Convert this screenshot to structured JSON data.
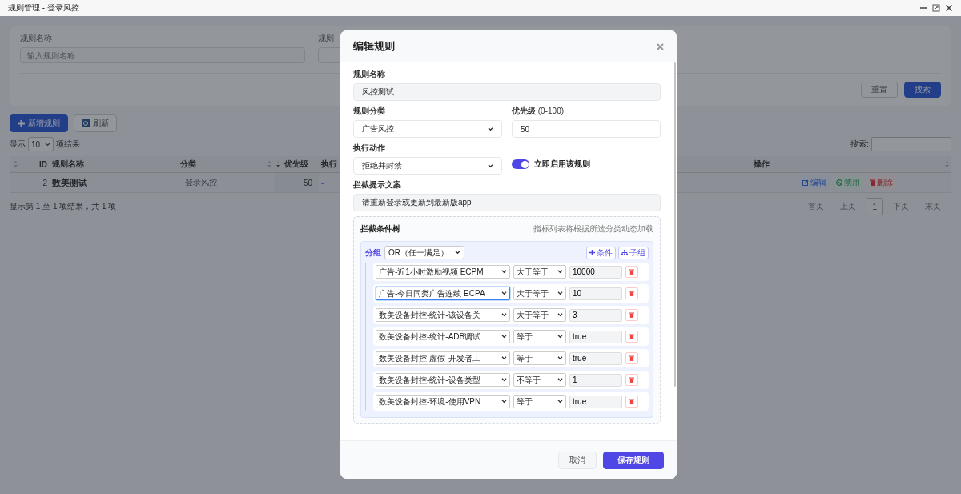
{
  "window": {
    "title": "规则管理 - 登录风控"
  },
  "filters": [
    {
      "label": "规则名称",
      "placeholder": "输入规则名称"
    },
    {
      "label": "规则"
    }
  ],
  "filter_buttons": [
    {
      "label": "重置",
      "kind": "secondary"
    },
    {
      "label": "搜索",
      "kind": "primary"
    }
  ],
  "toolbar": [
    {
      "label": "新增规则",
      "kind": "add"
    },
    {
      "label": "刷新",
      "kind": "refresh"
    }
  ],
  "page_length": {
    "prefix": "显示",
    "value": "10",
    "suffix": "项结果"
  },
  "search": {
    "label": "搜索:"
  },
  "table": {
    "columns": [
      {
        "kind": "check"
      },
      {
        "label": "ID"
      },
      {
        "label": "规则名称"
      },
      {
        "label": "分类"
      },
      {
        "label": "优先级"
      },
      {
        "label": "执行"
      },
      {
        "label": "操作"
      }
    ],
    "rows": [
      {
        "id": "2",
        "name": "数美测试",
        "category": "登录风控",
        "priority": "50",
        "action": "-",
        "actions": [
          {
            "label": "编辑",
            "kind": "edit"
          },
          {
            "label": "禁用",
            "kind": "disable"
          },
          {
            "label": "删除",
            "kind": "delete"
          }
        ]
      }
    ]
  },
  "info": "显示第 1 至 1 项结果，共 1 项",
  "pagination": [
    {
      "label": "首页",
      "selected": false
    },
    {
      "label": "上页",
      "selected": false
    },
    {
      "label": "1",
      "selected": true
    },
    {
      "label": "下页",
      "selected": false
    },
    {
      "label": "末页",
      "selected": false
    }
  ],
  "modal": {
    "title": "编辑规则",
    "name": {
      "label": "规则名称",
      "value": "风控测试"
    },
    "category": {
      "label": "规则分类",
      "value": "广告风控"
    },
    "priority": {
      "label": "优先级",
      "hint": "(0-100)",
      "value": "50"
    },
    "action": {
      "label": "执行动作",
      "value": "拒绝并封禁"
    },
    "enable": {
      "label": "立即启用该规则",
      "on": true
    },
    "message": {
      "label": "拦截提示文案",
      "value": "请重新登录或更新到最新版app"
    },
    "tree": {
      "title": "拦截条件树",
      "hint": "指标列表将根据所选分类动态加载",
      "group": {
        "label": "分组",
        "logic": "OR（任一满足）",
        "buttons": [
          {
            "label": "条件",
            "kind": "condition"
          },
          {
            "label": "子组",
            "kind": "subgroup"
          }
        ],
        "conditions": [
          {
            "field": "广告-近1小时激励视频 ECPM",
            "operator": "大于等于",
            "value": "10000",
            "focused": false
          },
          {
            "field": "广告-今日同类广告连续 ECPA",
            "operator": "大于等于",
            "value": "10",
            "focused": true
          },
          {
            "field": "数美设备封控-统计-该设备关",
            "operator": "大于等于",
            "value": "3",
            "focused": false
          },
          {
            "field": "数美设备封控-统计-ADB调试",
            "operator": "等于",
            "value": "true",
            "focused": false
          },
          {
            "field": "数美设备封控-虚假-开发者工",
            "operator": "等于",
            "value": "true",
            "focused": false
          },
          {
            "field": "数美设备封控-统计-设备类型",
            "operator": "不等于",
            "value": "1",
            "focused": false
          },
          {
            "field": "数美设备封控-环境-使用VPN",
            "operator": "等于",
            "value": "true",
            "focused": false
          }
        ]
      }
    },
    "buttons": [
      {
        "label": "取消",
        "kind": "cancel"
      },
      {
        "label": "保存规则",
        "kind": "save"
      }
    ]
  }
}
